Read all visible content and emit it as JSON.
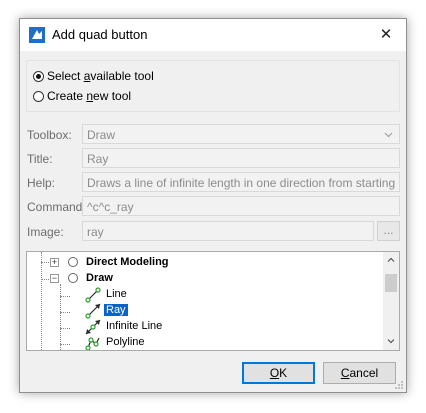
{
  "window": {
    "title": "Add quad button",
    "icon": "app-logo-icon",
    "close_glyph": "✕"
  },
  "mode": {
    "options": [
      {
        "label_pre": "Select ",
        "label_u": "a",
        "label_post": "vailable tool",
        "checked": true
      },
      {
        "label_pre": "Create ",
        "label_u": "n",
        "label_post": "ew tool",
        "checked": false
      }
    ]
  },
  "fields": {
    "toolbox": {
      "label": "Toolbox:",
      "value": "Draw"
    },
    "title": {
      "label": "Title:",
      "value": "Ray"
    },
    "help": {
      "label": "Help:",
      "value": "Draws a line of infinite length in one direction from starting point"
    },
    "command": {
      "label": "Command:",
      "value": "^c^c_ray"
    },
    "image": {
      "label": "Image:",
      "value": "ray",
      "browse_label": "..."
    }
  },
  "tree": {
    "groups": [
      {
        "label": "Direct Modeling",
        "expander": "+"
      },
      {
        "label": "Draw",
        "expander": "−"
      }
    ],
    "items": [
      {
        "label": "Line",
        "icon": "line-tool-icon",
        "selected": false
      },
      {
        "label": "Ray",
        "icon": "ray-tool-icon",
        "selected": true
      },
      {
        "label": "Infinite Line",
        "icon": "infinite-line-tool-icon",
        "selected": false
      },
      {
        "label": "Polyline",
        "icon": "polyline-tool-icon",
        "selected": false
      }
    ]
  },
  "buttons": {
    "ok": {
      "label_u": "O",
      "label_post": "K"
    },
    "cancel": {
      "label_u": "C",
      "label_post": "ancel"
    }
  },
  "colors": {
    "accent": "#0078d7",
    "selection": "#0a64c8"
  }
}
